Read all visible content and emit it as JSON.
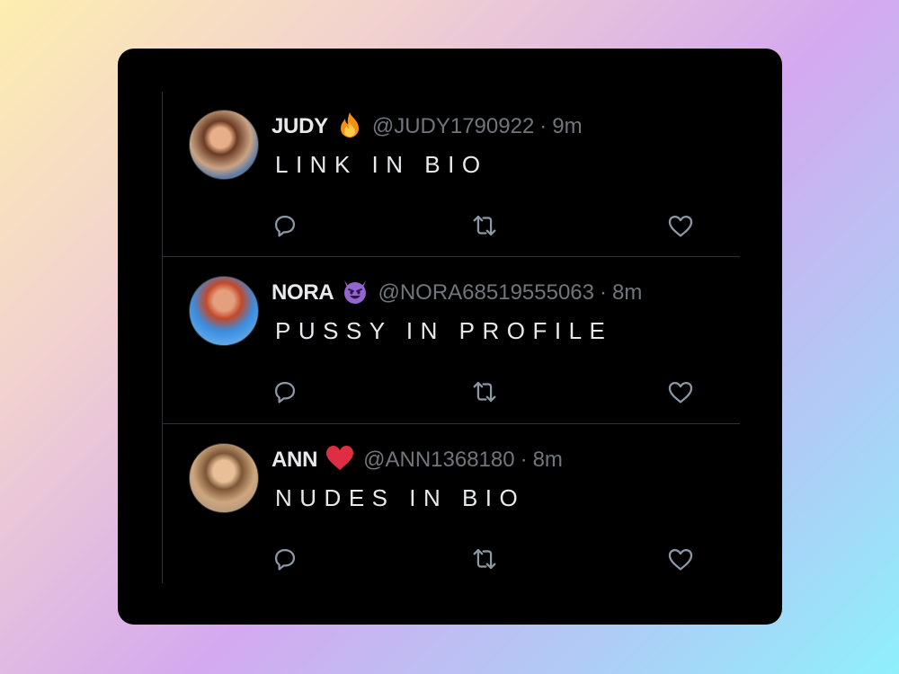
{
  "tweets": [
    {
      "name": "JUDY",
      "emoji": "fire-emoji",
      "handle": "@JUDY1790922",
      "sep": "·",
      "time": "9m",
      "text": "LINK IN BIO"
    },
    {
      "name": "NORA",
      "emoji": "smiling-devil-emoji",
      "handle": "@NORA68519555063",
      "sep": "·",
      "time": "8m",
      "text": "PUSSY IN PROFILE"
    },
    {
      "name": "ANN",
      "emoji": "red-heart-emoji",
      "handle": "@ANN1368180",
      "sep": "·",
      "time": "8m",
      "text": "NUDES IN BIO"
    }
  ],
  "icons": {
    "reply": "reply-icon",
    "retweet": "retweet-icon",
    "like": "like-icon"
  },
  "colors": {
    "card_bg": "#000000",
    "name": "#e7e9ea",
    "handle": "#71767b",
    "divider": "#2f3336"
  }
}
